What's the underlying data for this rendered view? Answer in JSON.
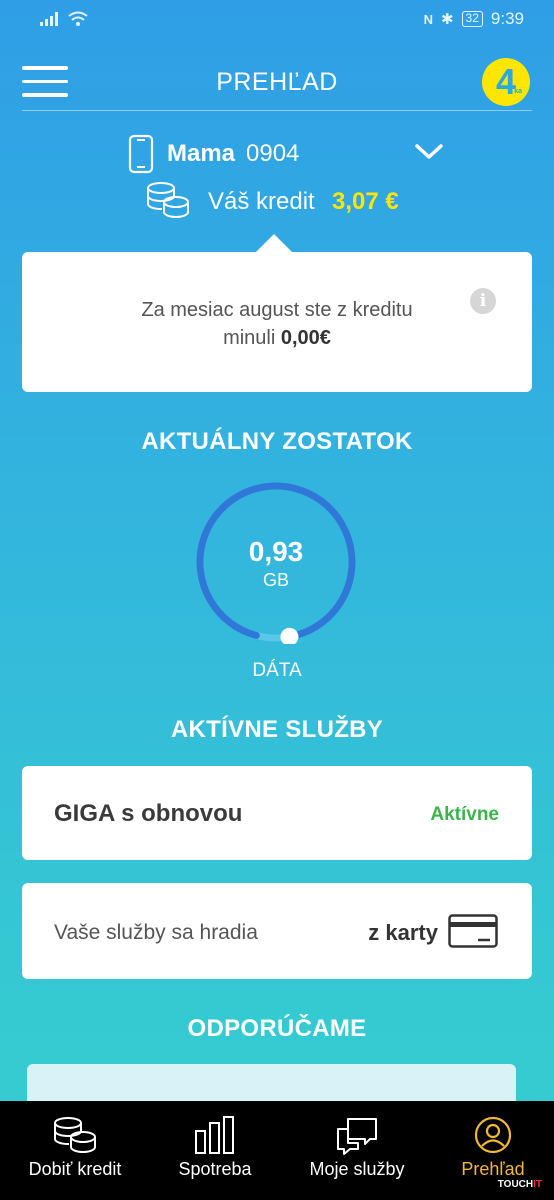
{
  "status_bar": {
    "time": "9:39",
    "battery": "32"
  },
  "header": {
    "title": "PREHĽAD",
    "logo_text": "4",
    "logo_small": "ka"
  },
  "account": {
    "name": "Mama",
    "number": "0904"
  },
  "credit": {
    "label": "Váš kredit",
    "value": "3,07 €"
  },
  "info_card": {
    "text": "Za mesiac august ste z kreditu minuli",
    "amount": "0,00€"
  },
  "balance": {
    "title": "AKTUÁLNY ZOSTATOK",
    "value": "0,93",
    "unit": "GB",
    "label": "DÁTA",
    "remaining_fraction": 0.93
  },
  "services": {
    "title": "AKTÍVNE SLUŽBY",
    "items": [
      {
        "name": "GIGA s obnovou",
        "status": "Aktívne"
      }
    ],
    "payment": {
      "label": "Vaše služby sa hradia",
      "value": "z karty"
    }
  },
  "recommend": {
    "title": "ODPORÚČAME"
  },
  "nav": {
    "items": [
      {
        "label": "Dobiť kredit",
        "icon": "coins-icon"
      },
      {
        "label": "Spotreba",
        "icon": "bar-chart-icon"
      },
      {
        "label": "Moje služby",
        "icon": "chat-icon"
      },
      {
        "label": "Prehľad",
        "icon": "profile-icon",
        "active": true
      }
    ]
  },
  "watermark": {
    "text": "TOUCH",
    "accent": "IT"
  },
  "colors": {
    "accent_yellow": "#ffe600",
    "active_green": "#3bb54a",
    "nav_active": "#f2b836",
    "gauge_blue": "#2f78d8"
  }
}
